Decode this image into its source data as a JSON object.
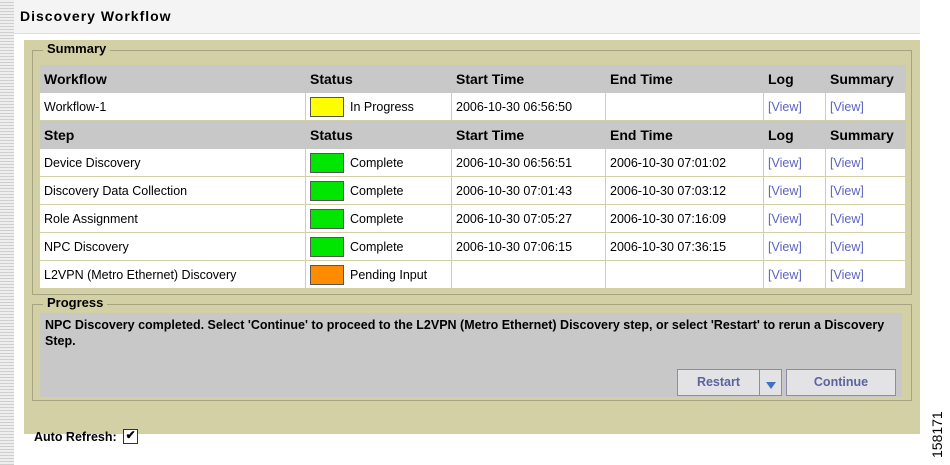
{
  "window": {
    "title": "Discovery Workflow"
  },
  "summary": {
    "legend": "Summary",
    "workflow_header": {
      "col_name": "Workflow",
      "status": "Status",
      "start_time": "Start Time",
      "end_time": "End Time",
      "log": "Log",
      "summary": "Summary"
    },
    "workflow_row": {
      "name": "Workflow-1",
      "status_color": "#ffff00",
      "status": "In Progress",
      "start_time": "2006-10-30 06:56:50",
      "end_time": "",
      "log": "[View]",
      "summary": "[View]"
    },
    "step_header": {
      "col_name": "Step",
      "status": "Status",
      "start_time": "Start Time",
      "end_time": "End Time",
      "log": "Log",
      "summary": "Summary"
    },
    "steps": [
      {
        "name": "Device Discovery",
        "status_color": "#00e600",
        "status": "Complete",
        "start_time": "2006-10-30 06:56:51",
        "end_time": "2006-10-30 07:01:02",
        "log": "[View]",
        "summary": "[View]"
      },
      {
        "name": "Discovery Data Collection",
        "status_color": "#00e600",
        "status": "Complete",
        "start_time": "2006-10-30 07:01:43",
        "end_time": "2006-10-30 07:03:12",
        "log": "[View]",
        "summary": "[View]"
      },
      {
        "name": "Role Assignment",
        "status_color": "#00e600",
        "status": "Complete",
        "start_time": "2006-10-30 07:05:27",
        "end_time": "2006-10-30 07:16:09",
        "log": "[View]",
        "summary": "[View]"
      },
      {
        "name": "NPC Discovery",
        "status_color": "#00e600",
        "status": "Complete",
        "start_time": "2006-10-30 07:06:15",
        "end_time": "2006-10-30 07:36:15",
        "log": "[View]",
        "summary": "[View]"
      },
      {
        "name": "L2VPN (Metro Ethernet) Discovery",
        "status_color": "#ff8c00",
        "status": "Pending Input",
        "start_time": "",
        "end_time": "",
        "log": "[View]",
        "summary": "[View]"
      }
    ]
  },
  "progress": {
    "legend": "Progress",
    "message": "NPC Discovery completed. Select 'Continue' to proceed to the L2VPN (Metro Ethernet) Discovery step, or select 'Restart' to rerun a Discovery Step.",
    "restart_label": "Restart",
    "continue_label": "Continue"
  },
  "auto_refresh": {
    "label": "Auto Refresh:",
    "checked": true
  },
  "figure_id": "158171"
}
